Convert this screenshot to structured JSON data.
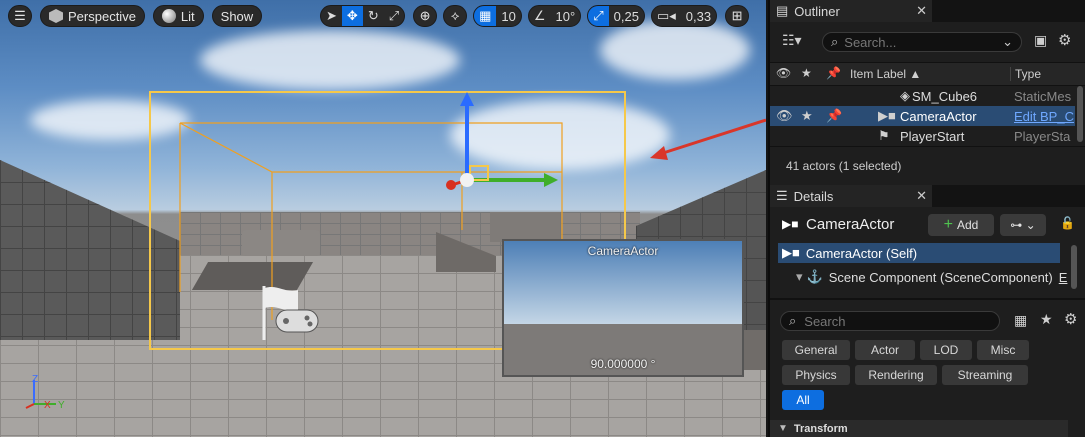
{
  "viewport": {
    "toolbar": {
      "menu_icon": "hamburger-icon",
      "perspective": "Perspective",
      "lit": "Lit",
      "show": "Show",
      "grid_snap": "10",
      "angle_snap": "10°",
      "scale_snap": "0,25",
      "camera_speed": "0,33"
    },
    "preview": {
      "title": "CameraActor",
      "fov": "90.000000 °"
    },
    "axis": {
      "z": "Z",
      "x": "X",
      "y": "Y"
    }
  },
  "outliner": {
    "title": "Outliner",
    "search_placeholder": "Search...",
    "columns": {
      "label": "Item Label ▲",
      "type": "Type"
    },
    "rows": [
      {
        "label": "SM_Cube6",
        "type": "StaticMes",
        "selected": false
      },
      {
        "label": "CameraActor",
        "type": "Edit BP_C",
        "selected": true
      },
      {
        "label": "PlayerStart",
        "type": "PlayerSta",
        "selected": false
      }
    ],
    "status": "41 actors (1 selected)"
  },
  "details": {
    "title": "Details",
    "actor_name": "CameraActor",
    "add_label": "Add",
    "components": [
      {
        "label": "CameraActor (Self)"
      },
      {
        "label": "Scene Component (SceneComponent)",
        "suffix": "E"
      }
    ],
    "search_placeholder": "Search",
    "categories_row1": [
      "General",
      "Actor",
      "LOD",
      "Misc"
    ],
    "categories_row2": [
      "Physics",
      "Rendering",
      "Streaming"
    ],
    "all_label": "All",
    "section": "Transform"
  },
  "colors": {
    "accent": "#0d6ee0",
    "selection": "#f5c84a"
  }
}
